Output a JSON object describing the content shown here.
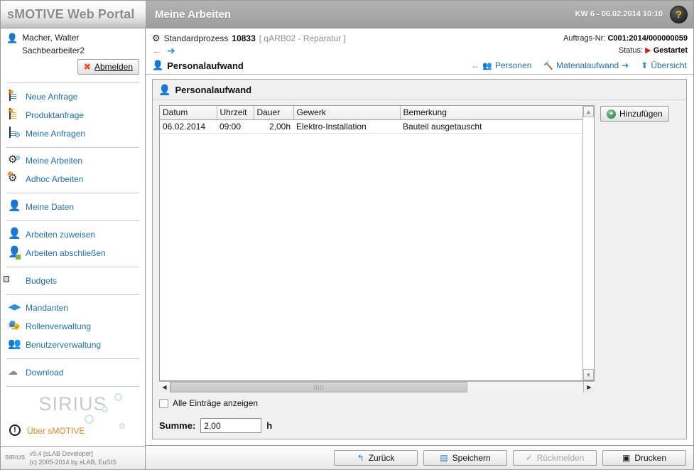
{
  "titlebar": {
    "brand": "sMOTIVE Web Portal",
    "page_title": "Meine Arbeiten",
    "datetime": "KW 6 - 06.02.2014 10:10",
    "help_icon": "question-mark-icon",
    "help_glyph": "?"
  },
  "sidebar": {
    "user_name": "Macher, Walter",
    "user_role": "Sachbearbeiter2",
    "logout_label": "Abmelden",
    "logout_accesskey": "A",
    "groups": [
      {
        "items": [
          {
            "label": "Neue Anfrage",
            "icon": "new-request-icon"
          },
          {
            "label": "Produktanfrage",
            "icon": "product-request-icon"
          },
          {
            "label": "Meine Anfragen",
            "icon": "my-requests-icon"
          }
        ]
      },
      {
        "items": [
          {
            "label": "Meine Arbeiten",
            "icon": "gear-icon"
          },
          {
            "label": "Adhoc Arbeiten",
            "icon": "adhoc-gear-icon"
          }
        ]
      },
      {
        "items": [
          {
            "label": "Meine Daten",
            "icon": "person-icon"
          }
        ]
      },
      {
        "items": [
          {
            "label": "Arbeiten zuweisen",
            "icon": "assign-work-icon"
          },
          {
            "label": "Arbeiten abschließen",
            "icon": "complete-work-icon"
          }
        ]
      },
      {
        "items": [
          {
            "label": "Budgets",
            "icon": "wallet-icon"
          }
        ]
      },
      {
        "items": [
          {
            "label": "Mandanten",
            "icon": "clients-icon"
          },
          {
            "label": "Rollenverwaltung",
            "icon": "roles-icon"
          },
          {
            "label": "Benutzerverwaltung",
            "icon": "users-icon"
          }
        ]
      },
      {
        "items": [
          {
            "label": "Download",
            "icon": "cloud-download-icon"
          }
        ]
      }
    ],
    "logo_text": "SIRIUS",
    "about_label": "Über sMOTIVE",
    "about_icon": "info-icon",
    "footer_logo": "SIRIUS",
    "footer_version": "v9.4 [sLAB Developer]",
    "footer_copyright": "(c) 2005-2014 by sLAB, EuSIS"
  },
  "breadcrumb": {
    "process_label": "Standardprozess",
    "process_id": "10833",
    "process_sub": "[ qARB02 - Reparatur ]",
    "back_arrow": "←",
    "forward_arrow": "➜",
    "order_label": "Auftrags-Nr:",
    "order_value": "C001:2014/000000059",
    "status_label": "Status:",
    "status_value": "Gestartet",
    "status_glyph": "▶"
  },
  "tabbar": {
    "title": "Personalaufwand",
    "title_icon": "personnel-effort-icon",
    "links": [
      {
        "label": "Personen",
        "icon": "people-icon",
        "arrow_left": "←",
        "arrow_right": ""
      },
      {
        "label": "Materialaufwand",
        "icon": "hammer-icon",
        "arrow_left": "",
        "arrow_right": "➜"
      },
      {
        "label": "Übersicht",
        "icon": "up-arrow-icon",
        "arrow_left": "",
        "arrow_right": ""
      }
    ]
  },
  "panel": {
    "header": "Personalaufwand",
    "header_icon": "personnel-effort-icon",
    "add_button": "Hinzufügen",
    "add_icon": "plus-circle-icon",
    "table": {
      "columns": [
        "Datum",
        "Uhrzeit",
        "Dauer",
        "Gewerk",
        "Bemerkung"
      ],
      "rows": [
        {
          "Datum": "06.02.2014",
          "Uhrzeit": "09:00",
          "Dauer": "2,00h",
          "Gewerk": "Elektro-Installation",
          "Bemerkung": "Bauteil ausgetauscht"
        }
      ]
    },
    "show_all_label": "Alle Einträge anzeigen",
    "show_all_accesskey": "E",
    "show_all_checked": false,
    "sum_label": "Summe:",
    "sum_value": "2,00",
    "sum_unit": "h",
    "scroll_up_glyph": "▲",
    "scroll_down_glyph": "▼",
    "scroll_left_glyph": "◀",
    "scroll_right_glyph": "▶",
    "hthumb_grip": "|||||"
  },
  "bottombar": {
    "buttons": [
      {
        "label": "Zurück",
        "icon": "undo-icon",
        "glyph": "↰",
        "disabled": false
      },
      {
        "label": "Speichern",
        "icon": "save-disk-icon",
        "glyph": "▤",
        "disabled": false
      },
      {
        "label": "Rückmelden",
        "icon": "check-icon",
        "glyph": "✔",
        "disabled": true
      },
      {
        "label": "Drucken",
        "icon": "printer-icon",
        "glyph": "▣",
        "disabled": false
      }
    ]
  },
  "colors": {
    "link": "#1f6fb4",
    "accent_blue": "#2f8fd0",
    "accent_orange": "#e08820",
    "status_red": "#cc2222",
    "header_grey": "#a9a9a9"
  }
}
